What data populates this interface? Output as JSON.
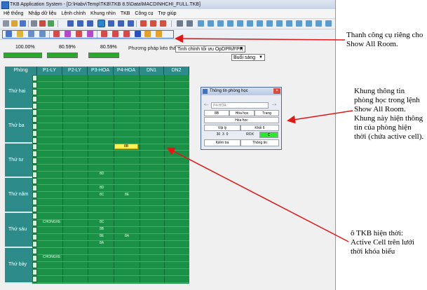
{
  "window": {
    "title": "TKB Application System - [D:\\Habv\\Temp\\TKB\\TKB 8.5\\Data\\MACDINHCHI_FULL.TKB]"
  },
  "menu": [
    "Hệ thống",
    "Nhập dữ liệu",
    "Lệnh chính",
    "Khung nhìn",
    "TKB",
    "Công cụ",
    "Trợ giúp"
  ],
  "progress": [
    {
      "label": "100.00%",
      "value": 1.0
    },
    {
      "label": "80.59%",
      "value": 0.8059
    },
    {
      "label": "80.59%",
      "value": 0.8059
    }
  ],
  "controls": {
    "method_label": "Phương pháp kéo thả:",
    "method_value": "Tinh chỉnh tối ưu OpDPR/FPR",
    "session_value": "Buổi sáng"
  },
  "grid": {
    "corner": "Phòng",
    "columns": [
      "P1-LY",
      "P2-LY",
      "P3-HOA",
      "P4-HOA",
      "DN1",
      "DN2"
    ],
    "days": [
      "Thứ hai",
      "Thứ ba",
      "Thứ tư",
      "Thứ năm",
      "Thứ sáu",
      "Thứ bảy"
    ],
    "cells": {
      "active": "8B",
      "wed_p3_6": "8D",
      "thu_p3_1": "8D",
      "thu_p3_2": "8C",
      "thu_p4_2": "8E",
      "fri_p1_1": "CHONGXE",
      "fri_p3_1": "8C",
      "fri_p3_2": "8B",
      "fri_p3_3": "8E",
      "fri_p4_3": "8A",
      "fri_p3_4": "8A",
      "sat_p1_1": "CHONGXE"
    }
  },
  "dialog": {
    "title": "Thông tin phòng học",
    "room": "P4-HOA",
    "class": "8B",
    "subject": "Hóa học",
    "teacher": "Trang",
    "subject2": "Hóa học",
    "category": "Vật lý",
    "block": "Khối 6",
    "n1": "30",
    "n2": "3",
    "n3": "0",
    "code": "ROX",
    "status": "C",
    "btn_check": "Kiểm tra",
    "btn_info": "Thông tin"
  },
  "annotations": {
    "toolbar": "Thanh công cụ riêng cho Show All Room.",
    "dialog": "Khung thông tin phòng học trong lệnh Show All Room. Khung này hiện thông tin của phòng hiện thời (chứa active cell).",
    "cell": "ô TKB hiện thời: Active Cell trên lưới thời khóa biểu"
  },
  "colors": {
    "grid": "#1a9146",
    "header": "#2d8b8a",
    "active": "#fff15a",
    "arrow": "#e01818"
  }
}
